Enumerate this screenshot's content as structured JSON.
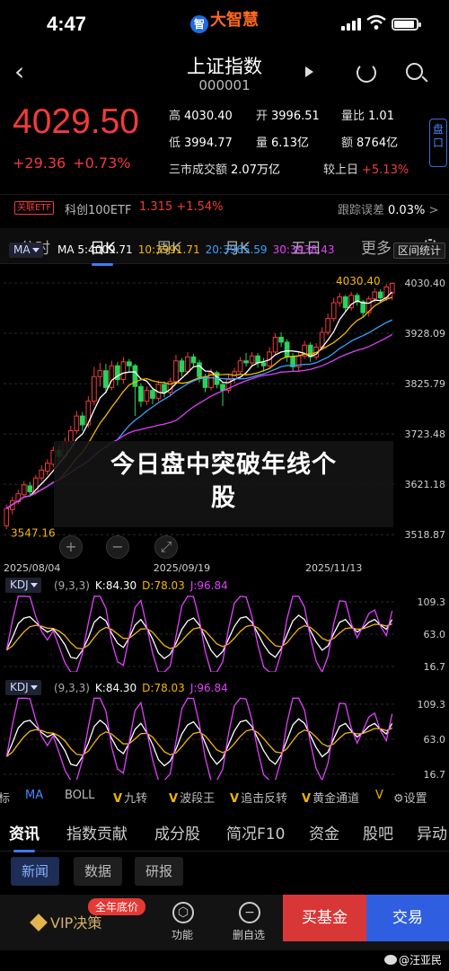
{
  "status_bar": {
    "time": "4:47",
    "brand": "大智慧",
    "logo_glyph": "智"
  },
  "nav": {
    "back_glyph": "‹",
    "title": "上证指数",
    "code": "000001"
  },
  "quote": {
    "price": "4029.50",
    "change": "+29.36",
    "change_pct": "+0.73%",
    "stats": [
      {
        "k": "高",
        "v": "4030.40",
        "red": false
      },
      {
        "k": "开",
        "v": "3996.51",
        "red": false
      },
      {
        "k": "量比",
        "v": "1.01",
        "red": false
      },
      {
        "k": "低",
        "v": "3994.77",
        "red": false
      },
      {
        "k": "量",
        "v": "6.13亿",
        "red": false
      },
      {
        "k": "额",
        "v": "8764亿",
        "red": false
      },
      {
        "k": "三市成交额",
        "v": "2.07万亿",
        "red": false
      },
      {
        "k": "较上日",
        "v": "+5.13%",
        "red": true
      }
    ],
    "panel_tab": "盘口"
  },
  "etf": {
    "tag": "关联ETF",
    "name": "科创100ETF",
    "value": "1.315 +1.54%",
    "track_label": "跟踪误差",
    "track_value": "0.03%",
    "track_arrow": ">"
  },
  "period_tabs": [
    "分时",
    "日K",
    "周K",
    "月K",
    "五日",
    "更多"
  ],
  "ma": {
    "selector": "MA",
    "values": [
      {
        "text": "MA 5:4009.71",
        "color": "#ffffff"
      },
      {
        "text": "10:3991.71",
        "color": "#f5b700"
      },
      {
        "text": "20:3965.59",
        "color": "#3aa0ff"
      },
      {
        "text": "30:3938.43",
        "color": "#e040fb"
      }
    ],
    "range_button": "区间统计"
  },
  "chart_data": [
    {
      "type": "candlestick",
      "title": "",
      "ylim": [
        3470,
        4065
      ],
      "y_ticks": [
        "4030.40",
        "3928.09",
        "3825.79",
        "3723.48",
        "3621.18",
        "3518.87"
      ],
      "x_ticks": [
        "2025/08/04",
        "2025/09/19",
        "2025/11/13"
      ],
      "annotations": {
        "high": "4030.40",
        "low": "3547.16"
      },
      "ma_colors": {
        "MA5": "#ffffff",
        "MA10": "#f5b700",
        "MA20": "#3aa0ff",
        "MA30": "#e040fb"
      },
      "candles": [
        [
          3537,
          3572,
          3580,
          3530
        ],
        [
          3570,
          3588,
          3596,
          3560
        ],
        [
          3586,
          3602,
          3610,
          3580
        ],
        [
          3600,
          3620,
          3628,
          3594
        ],
        [
          3618,
          3606,
          3626,
          3598
        ],
        [
          3605,
          3634,
          3640,
          3600
        ],
        [
          3634,
          3650,
          3660,
          3628
        ],
        [
          3648,
          3664,
          3672,
          3640
        ],
        [
          3662,
          3690,
          3698,
          3656
        ],
        [
          3690,
          3678,
          3700,
          3668
        ],
        [
          3678,
          3708,
          3716,
          3672
        ],
        [
          3708,
          3730,
          3740,
          3700
        ],
        [
          3730,
          3760,
          3770,
          3724
        ],
        [
          3760,
          3742,
          3768,
          3730
        ],
        [
          3742,
          3790,
          3800,
          3736
        ],
        [
          3790,
          3840,
          3860,
          3782
        ],
        [
          3840,
          3852,
          3868,
          3820
        ],
        [
          3852,
          3818,
          3866,
          3806
        ],
        [
          3818,
          3862,
          3872,
          3812
        ],
        [
          3862,
          3834,
          3870,
          3822
        ],
        [
          3834,
          3870,
          3880,
          3826
        ],
        [
          3870,
          3862,
          3876,
          3850
        ],
        [
          3862,
          3820,
          3866,
          3760
        ],
        [
          3820,
          3790,
          3826,
          3778
        ],
        [
          3790,
          3812,
          3820,
          3782
        ],
        [
          3812,
          3796,
          3818,
          3784
        ],
        [
          3796,
          3824,
          3832,
          3790
        ],
        [
          3824,
          3808,
          3830,
          3798
        ],
        [
          3808,
          3830,
          3838,
          3800
        ],
        [
          3830,
          3872,
          3884,
          3824
        ],
        [
          3872,
          3850,
          3878,
          3840
        ],
        [
          3850,
          3880,
          3890,
          3844
        ],
        [
          3880,
          3868,
          3886,
          3858
        ],
        [
          3868,
          3840,
          3874,
          3828
        ],
        [
          3840,
          3818,
          3846,
          3808
        ],
        [
          3818,
          3848,
          3856,
          3812
        ],
        [
          3848,
          3824,
          3852,
          3816
        ],
        [
          3824,
          3812,
          3830,
          3780
        ],
        [
          3812,
          3836,
          3844,
          3806
        ],
        [
          3836,
          3850,
          3858,
          3826
        ],
        [
          3850,
          3872,
          3880,
          3844
        ],
        [
          3872,
          3868,
          3888,
          3860
        ],
        [
          3868,
          3882,
          3890,
          3862
        ],
        [
          3882,
          3868,
          3888,
          3858
        ],
        [
          3868,
          3862,
          3878,
          3850
        ],
        [
          3862,
          3890,
          3900,
          3856
        ],
        [
          3890,
          3920,
          3928,
          3884
        ],
        [
          3920,
          3910,
          3930,
          3900
        ],
        [
          3910,
          3880,
          3916,
          3870
        ],
        [
          3880,
          3860,
          3888,
          3850
        ],
        [
          3860,
          3882,
          3890,
          3852
        ],
        [
          3882,
          3904,
          3912,
          3876
        ],
        [
          3904,
          3880,
          3910,
          3870
        ],
        [
          3880,
          3900,
          3908,
          3874
        ],
        [
          3900,
          3930,
          3940,
          3894
        ],
        [
          3930,
          3958,
          3968,
          3924
        ],
        [
          3958,
          3990,
          4000,
          3952
        ],
        [
          3990,
          4002,
          4010,
          3982
        ],
        [
          4002,
          3980,
          4006,
          3972
        ],
        [
          3980,
          4005,
          4012,
          3974
        ],
        [
          4005,
          3992,
          4010,
          3984
        ],
        [
          3992,
          3970,
          3996,
          3960
        ],
        [
          3970,
          3998,
          4004,
          3962
        ],
        [
          3998,
          4012,
          4020,
          3990
        ],
        [
          4012,
          4000,
          4018,
          3992
        ],
        [
          4000,
          4022,
          4028,
          3994
        ],
        [
          4010,
          4029.5,
          4030.4,
          3994.77
        ]
      ]
    },
    {
      "type": "line",
      "title": "KDJ",
      "ylim": [
        16.7,
        109.3
      ],
      "y_ticks": [
        "109.3",
        "63.0",
        "16.7"
      ],
      "params": "(9,3,3)",
      "series": [
        {
          "name": "K",
          "latest": "84.30",
          "color": "#ffffff"
        },
        {
          "name": "D",
          "latest": "78.03",
          "color": "#f5b700"
        },
        {
          "name": "J",
          "latest": "96.84",
          "color": "#e040fb"
        }
      ],
      "k_values": [
        40,
        58,
        78,
        86,
        88,
        80,
        72,
        66,
        70,
        60,
        48,
        30,
        28,
        40,
        58,
        80,
        88,
        82,
        64,
        50,
        44,
        58,
        76,
        84,
        72,
        56,
        36,
        28,
        34,
        50,
        70,
        82,
        86,
        76,
        58,
        40,
        30,
        38,
        56,
        74,
        86,
        88,
        80,
        64,
        48,
        36,
        30,
        42,
        62,
        82,
        90,
        84,
        68,
        52,
        40,
        46,
        64,
        80,
        84,
        74,
        66,
        72,
        80,
        84,
        76,
        70,
        84
      ]
    }
  ],
  "kdj_panels": [
    {
      "selector": "KDJ",
      "params": "(9,3,3)",
      "k": "K:84.30",
      "d": "D:78.03",
      "j": "J:96.84"
    },
    {
      "selector": "KDJ",
      "params": "(9,3,3)",
      "k": "K:84.30",
      "d": "D:78.03",
      "j": "J:96.84"
    }
  ],
  "indicator_bar": {
    "items": [
      "标",
      "MA",
      "BOLL",
      "九转",
      "波段王",
      "追击反转",
      "黄金通道",
      "设置"
    ],
    "v_mark": "V"
  },
  "section_tabs": [
    "资讯",
    "指数贡献",
    "成分股",
    "简况F10",
    "资金",
    "股吧",
    "异动"
  ],
  "subtabs": [
    "新闻",
    "数据",
    "研报"
  ],
  "bottom_bar": {
    "vip": "VIP决策",
    "badge": "全年底价",
    "func": "功能",
    "func_glyph": "⬡",
    "delete": "删自选",
    "delete_glyph": "−",
    "buy": "买基金",
    "trade": "交易"
  },
  "overlay": {
    "line1": "今日盘中突破年线个",
    "line2": "股"
  },
  "watermark": "@汪亚民"
}
